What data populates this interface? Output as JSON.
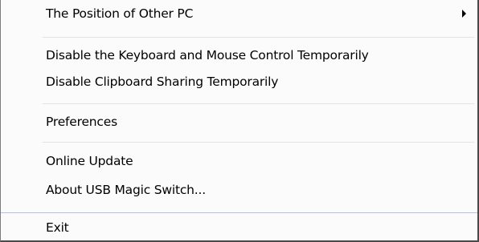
{
  "menu": {
    "items": [
      {
        "label": "The Position of Other PC",
        "has_submenu": true
      },
      {
        "label": "Disable the Keyboard and Mouse Control Temporarily"
      },
      {
        "label": "Disable Clipboard Sharing Temporarily"
      },
      {
        "label": "Preferences"
      },
      {
        "label": "Online Update"
      },
      {
        "label": "About USB Magic Switch..."
      },
      {
        "label": "Exit"
      }
    ]
  },
  "colors": {
    "menu_background": "#fbfbfb",
    "separator": "#e2e3e3",
    "highlight_line": "#a9c4e8",
    "text": "#000000"
  },
  "icons": {
    "submenu": "submenu-arrow-icon"
  }
}
